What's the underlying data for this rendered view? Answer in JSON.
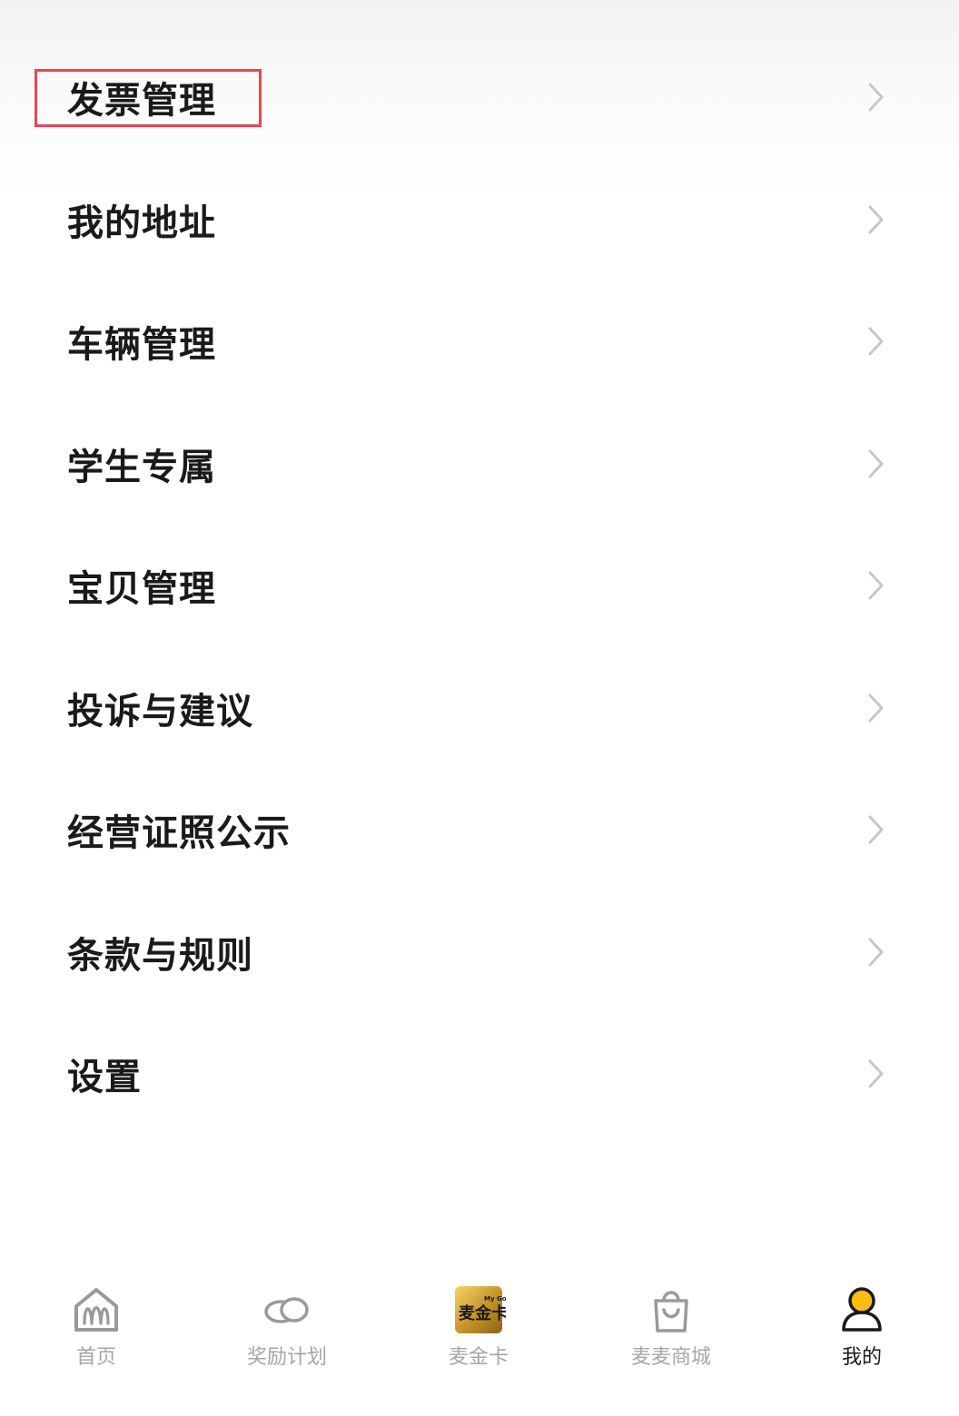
{
  "menu": {
    "items": [
      {
        "label": "发票管理"
      },
      {
        "label": "我的地址"
      },
      {
        "label": "车辆管理"
      },
      {
        "label": "学生专属"
      },
      {
        "label": "宝贝管理"
      },
      {
        "label": "投诉与建议"
      },
      {
        "label": "经营证照公示"
      },
      {
        "label": "条款与规则"
      },
      {
        "label": "设置"
      }
    ],
    "chevron_icon": "chevron-right-icon",
    "highlighted_item": "发票管理",
    "highlight_color": "#e8474f"
  },
  "tabbar": {
    "tabs": [
      {
        "label": "首页",
        "icon": "mcdonalds-home-icon"
      },
      {
        "label": "奖励计划",
        "icon": "coins-icon"
      },
      {
        "label": "麦金卡",
        "icon": "my-gold-card-icon",
        "icon_text": "麦金卡",
        "icon_subtext": "My Gold"
      },
      {
        "label": "麦麦商城",
        "icon": "shopping-bag-icon"
      },
      {
        "label": "我的",
        "icon": "user-profile-icon"
      }
    ],
    "active": "我的",
    "accent_color": "#ffbc0d"
  }
}
